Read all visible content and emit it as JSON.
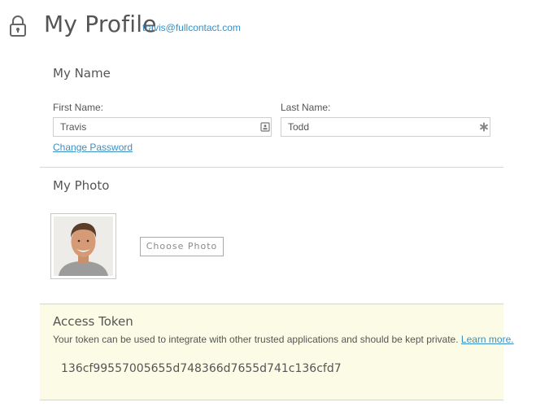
{
  "header": {
    "title": "My Profile",
    "email": "travis@fullcontact.com",
    "icon": "lock-icon"
  },
  "name_section": {
    "title": "My Name",
    "first_name_label": "First Name:",
    "first_name_value": "Travis",
    "first_name_icon": "contact-card-icon",
    "last_name_label": "Last Name:",
    "last_name_value": "Todd",
    "last_name_icon": "required-asterisk-icon",
    "change_password_label": "Change Password"
  },
  "photo_section": {
    "title": "My Photo",
    "choose_photo_label": "Choose Photo"
  },
  "token_section": {
    "title": "Access Token",
    "description": "Your token can be used to integrate with other trusted applications and should be kept private.",
    "learn_more_label": "Learn more.",
    "token": "136cf99557005655d748366d7655d741c136cfd7"
  },
  "colors": {
    "link": "#3a8fc4",
    "token_background": "#fcfce6",
    "text": "#555555",
    "divider": "#d6d6d6"
  }
}
